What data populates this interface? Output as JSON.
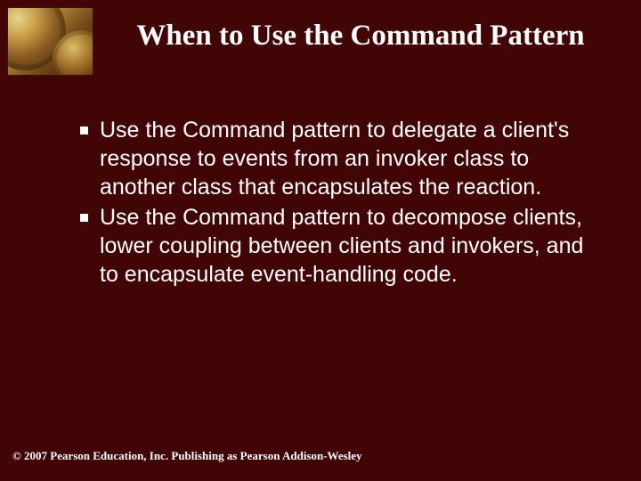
{
  "title": "When to Use the Command Pattern",
  "bullets": [
    "Use the Command pattern to delegate a client's response to events from an invoker class to another class that encapsulates the reaction.",
    "Use the Command pattern to decompose clients, lower coupling between clients and invokers, and to encapsulate event-handling code."
  ],
  "footer": "© 2007 Pearson Education, Inc. Publishing as Pearson Addison-Wesley"
}
